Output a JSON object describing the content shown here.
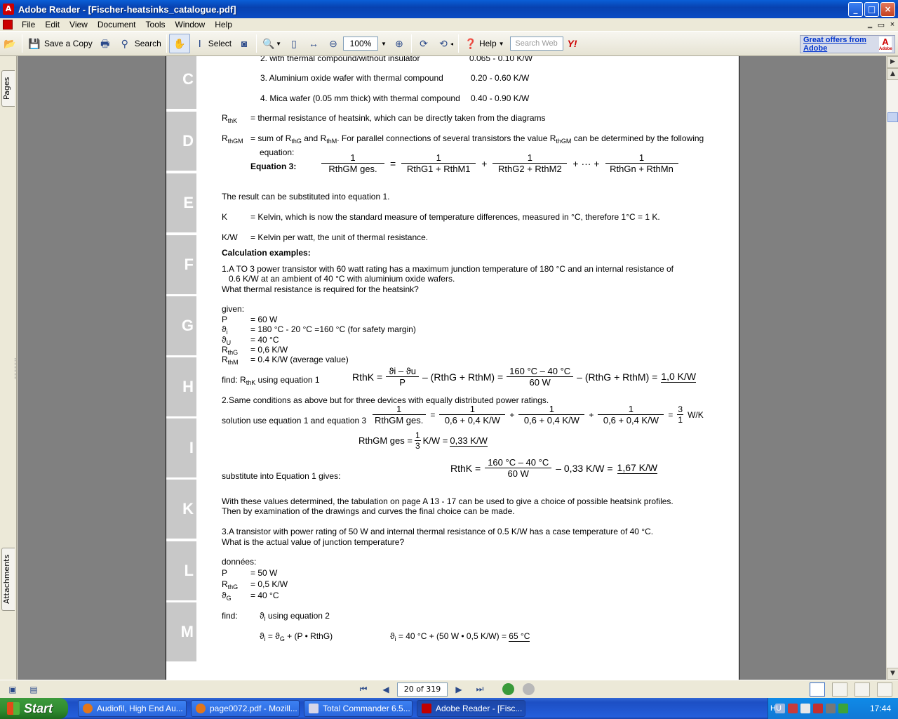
{
  "window": {
    "title": "Adobe Reader - [Fischer-heatsinks_catalogue.pdf]",
    "app_icon_glyph": "A",
    "controls": {
      "min": "_",
      "max": "□",
      "close": "×"
    }
  },
  "menu": {
    "items": [
      "File",
      "Edit",
      "View",
      "Document",
      "Tools",
      "Window",
      "Help"
    ],
    "mdi": {
      "min": "‗",
      "restore": "▭",
      "close": "×"
    }
  },
  "toolbar": {
    "save_copy": "Save a Copy",
    "search": "Search",
    "select": "Select",
    "zoom_value": "100%",
    "help": "Help",
    "search_web_placeholder": "Search Web",
    "yahoo": "Y!",
    "adobe_offer": "Great offers from Adobe",
    "adobe_logo": "A",
    "adobe_logo_sub": "Adobe"
  },
  "nav": {
    "pages_tab": "Pages",
    "attachments_tab": "Attachments"
  },
  "tab_letters": [
    "C",
    "D",
    "E",
    "F",
    "G",
    "H",
    "I",
    "K",
    "L",
    "M"
  ],
  "doc": {
    "l0": "2. with thermal compound/without insulator",
    "l0v": "0.065 - 0.10 K/W",
    "l1": "3.  Aluminium oxide wafer with thermal compound",
    "l1v": "0.20  - 0.60 K/W",
    "l2": "4.  Mica wafer (0.05 mm thick) with thermal compound",
    "l2v": "0.40  - 0.90 K/W",
    "rthk_lbl_R": "R",
    "rthk_lbl_sub": "thK",
    "rthk_desc": "=  thermal resistance of heatsink, which can be directly taken from the diagrams",
    "rthgm_lbl_sub": "thGM",
    "rthgm_desc_a": "=  sum of R",
    "rthgm_desc_sub1": "thG",
    "rthgm_desc_b": " and R",
    "rthgm_desc_sub2": "thM",
    "rthgm_desc_c": ". For parallel connections of several transistors the value R",
    "rthgm_desc_sub3": "thGM",
    "rthgm_desc_d": " can be determined by the following",
    "equation_word": "equation:",
    "eq3_label": "Equation 3:",
    "eq3_f1_num": "1",
    "eq3_f1_den": "RthGM ges.",
    "eq3_eq": "=",
    "eq3_f2_num": "1",
    "eq3_f2_den": "RthG1 + RthM1",
    "eq3_plus": "+",
    "eq3_f3_num": "1",
    "eq3_f3_den": "RthG2 + RthM2",
    "eq3_dots": "+ ··· +",
    "eq3_f4_num": "1",
    "eq3_f4_den": "RthGn + RthMn",
    "result_line": "The result can be substituted into equation 1.",
    "k_lbl": "K",
    "k_desc": "=  Kelvin, which is now the standard measure of temperature differences, measured in °C, therefore 1°C = 1 K.",
    "kw_lbl": "K/W",
    "kw_desc": "=  Kelvin per watt, the unit of thermal resistance.",
    "calc_heading": "Calculation examples:",
    "ex1_a": "1.A TO 3 power transistor with 60 watt rating has a maximum junction temperature of 180 °C and an internal resistance of",
    "ex1_b": "0.6 K/W at an ambient of 40 °C with aluminium oxide wafers.",
    "ex1_c": "What thermal resistance is required for the heatsink?",
    "given": "given:",
    "g_p": "P",
    "g_p_v": "= 60 W",
    "g_ti": "ϑ",
    "g_ti_sub": "i",
    "g_ti_v": "= 180 °C - 20 °C =160 °C (for safety margin)",
    "g_tu": "ϑ",
    "g_tu_sub": "U",
    "g_tu_v": "= 40 °C",
    "g_rg": "R",
    "g_rg_sub": "thG",
    "g_rg_v": "= 0,6 K/W",
    "g_rm": "R",
    "g_rm_sub": "thM",
    "g_rm_v": "= 0.4 K/W (average value)",
    "find1_a": "find: R",
    "find1_sub": "thK",
    "find1_b": " using equation 1",
    "f1_lhs": "RthK =",
    "f1_num": "ϑi – ϑu",
    "f1_den": "P",
    "f1_mid": "– (RthG + RthM) =",
    "f1_num2": "160 °C – 40 °C",
    "f1_den2": "60 W",
    "f1_mid2": "– (RthG + RthM) =",
    "f1_res": "1,0 K/W",
    "ex2": "2.Same conditions as above but for three devices with equally distributed power ratings.",
    "sol": "solution use equation 1 and equation 3",
    "f2_n": "1",
    "f2_d1": "RthGM ges.",
    "f2_eq": "=",
    "f2_d2": "0,6 + 0,4 K/W",
    "f2_plus": "+",
    "f2_eq2": "=",
    "f2_r_num": "3",
    "f2_r_den": "1",
    "f2_unit": "W/K",
    "f3_lhs": "RthGM ges =",
    "f3_n": "1",
    "f3_d": "3",
    "f3_mid": "K/W =",
    "f3_res": "0,33 K/W",
    "subst": "substitute into Equation 1 gives:",
    "f4_lhs": "RthK =",
    "f4_num": "160 °C – 40 °C",
    "f4_den": "60 W",
    "f4_mid": "– 0,33 K/W =",
    "f4_res": "1,67 K/W",
    "tab_a": "With these values determined, the tabulation on page A 13 - 17 can be used to give a choice of possible heatsink profiles.",
    "tab_b": "Then by examination of the drawings and curves the final choice can be made.",
    "ex3_a": "3.A transistor with power rating of 50 W and internal thermal resistance of 0.5 K/W has a case temperature of 40 °C.",
    "ex3_b": "What is the actual value of junction temperature?",
    "donnees": "données:",
    "d_p": "P",
    "d_p_v": "= 50 W",
    "d_rg": "R",
    "d_rg_sub": "thG",
    "d_rg_v": "= 0,5 K/W",
    "d_tg": "ϑ",
    "d_tg_sub": "G",
    "d_tg_v": "= 40 °C",
    "find2": "find:",
    "find2_b": "ϑ",
    "find2_sub": "i",
    "find2_c": " using equation 2",
    "eq2_a": "ϑ",
    "eq2_a_sub": "i",
    "eq2_b": " = ϑ",
    "eq2_b_sub": "G",
    "eq2_c": " + (P • RthG)",
    "eq2r_a": "ϑ",
    "eq2r_sub": "i",
    "eq2r_b": " = 40 °C + (50 W • 0,5 K/W) = ",
    "eq2r_res": "65 °C"
  },
  "status": {
    "page": "20 of 319"
  },
  "taskbar": {
    "start": "Start",
    "tasks": [
      {
        "label": "Audiofil, High End Au...",
        "color": "#e2761b"
      },
      {
        "label": "page0072.pdf - Mozill...",
        "color": "#e2761b"
      },
      {
        "label": "Total Commander 6.5...",
        "color": "#d6d6e8"
      },
      {
        "label": "Adobe Reader - [Fisc...",
        "color": "#c00000"
      }
    ],
    "lang": "HU",
    "clock": "17:44"
  },
  "colors": {
    "tab_gray": "#c8c8c8",
    "title_blue": "#0842b0",
    "start_green": "#2f8a2f"
  }
}
